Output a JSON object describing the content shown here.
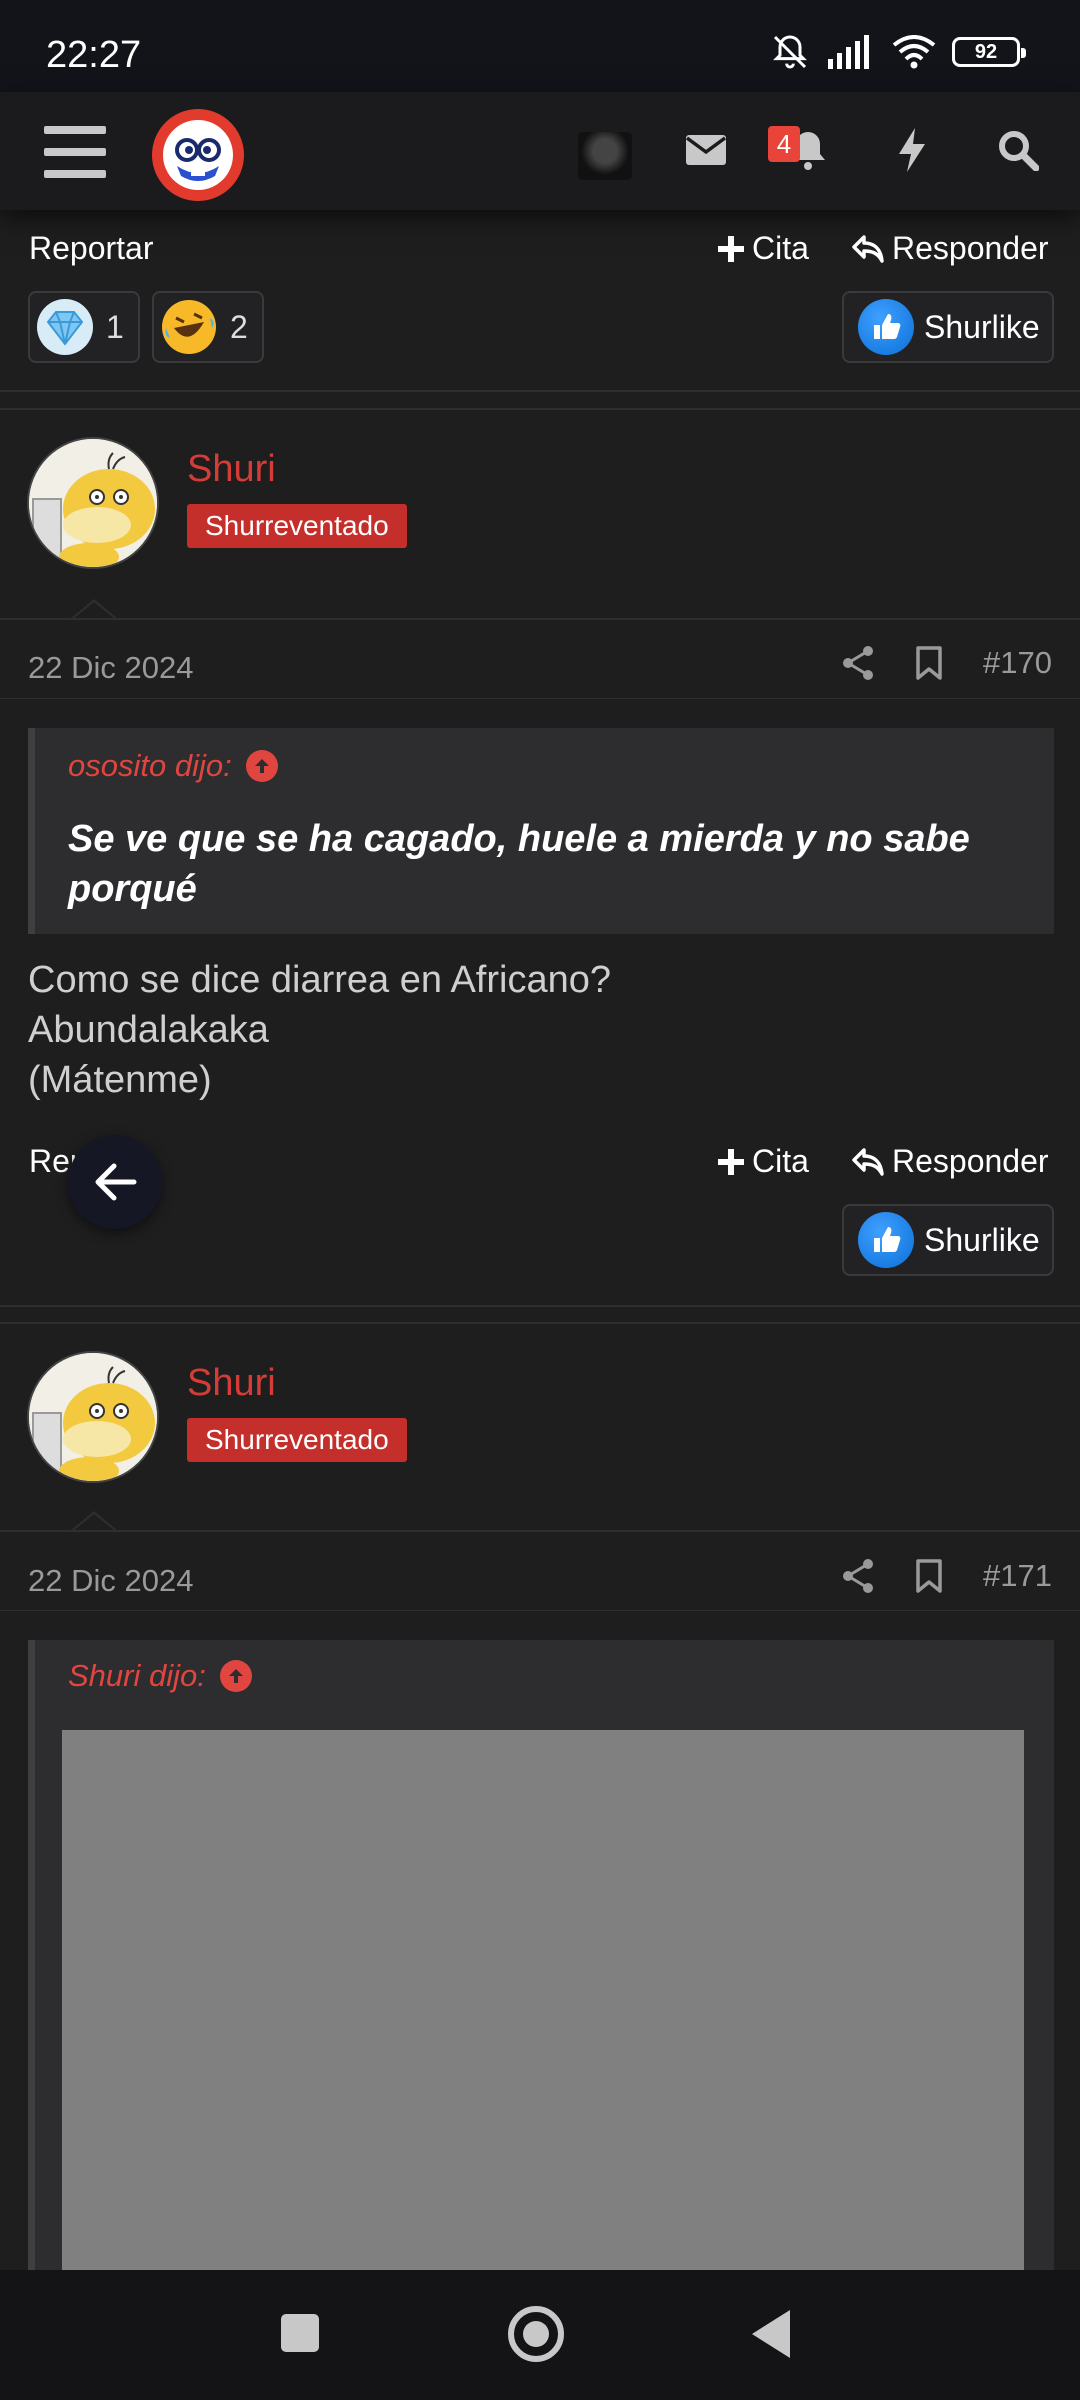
{
  "status_bar": {
    "time": "22:27",
    "battery": "92",
    "icons": [
      "bell-muted-icon",
      "signal-icon",
      "wifi-icon",
      "battery-icon"
    ]
  },
  "header": {
    "notifications_badge": "4",
    "icons": [
      "menu-icon",
      "site-logo",
      "user-avatar",
      "mail-icon",
      "bell-icon",
      "bolt-icon",
      "search-icon"
    ]
  },
  "post_prev": {
    "report_label": "Reportar",
    "quote_label": "Cita",
    "reply_label": "Responder",
    "reactions": [
      {
        "icon": "diamond-icon",
        "count": "1"
      },
      {
        "icon": "laugh-emoji-icon",
        "count": "2"
      }
    ],
    "like_label": "Shurlike"
  },
  "post170": {
    "username": "Shuri",
    "user_title": "Shurreventado",
    "date": "22 Dic 2024",
    "number": "#170",
    "quote_author": "ososito dijo:",
    "quote_text": "Se ve que se ha cagado, huele a mierda y no sabe porqué",
    "body_lines": [
      "Como se dice diarrea en Africano?",
      "Abundalakaka",
      "(Mátenme)"
    ],
    "report_label": "Reportar",
    "quote_label": "Cita",
    "reply_label": "Responder",
    "like_label": "Shurlike"
  },
  "post171": {
    "username": "Shuri",
    "user_title": "Shurreventado",
    "date": "22 Dic 2024",
    "number": "#171",
    "quote_author": "Shuri dijo:"
  },
  "colors": {
    "accent_red": "#d63c37",
    "badge_red": "#c52f2b",
    "like_blue": "#1a85f0",
    "background": "#1e1e1f"
  }
}
